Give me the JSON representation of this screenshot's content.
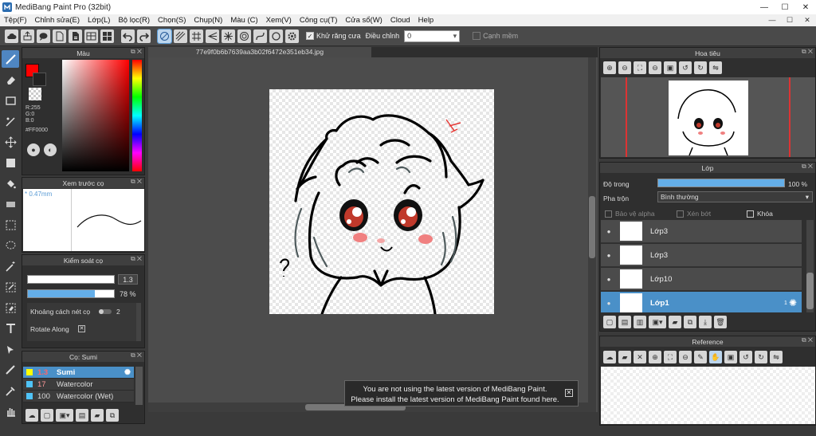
{
  "window": {
    "title": "MediBang Paint Pro (32bit)",
    "minimize": "—",
    "maximize": "☐",
    "close": "✕"
  },
  "menu": [
    "Tệp(F)",
    "Chỉnh sửa(E)",
    "Lớp(L)",
    "Bộ lọc(R)",
    "Chọn(S)",
    "Chụp(N)",
    "Màu (C)",
    "Xem(V)",
    "Công cụ(T)",
    "Cửa sổ(W)",
    "Cloud",
    "Help"
  ],
  "toolbar": {
    "antialias_label": "Khử răng cưa",
    "correction_label": "Điều chỉnh",
    "correction_value": "0",
    "snap_edge_label": "Cạnh mềm"
  },
  "color_panel": {
    "title": "Màu",
    "r": "R:255",
    "g": "G:0",
    "b": "B:0",
    "hex": "#FF0000",
    "primary_color": "#ff0000"
  },
  "brush_preview": {
    "title": "Xem trước cọ",
    "size": "* 0.47mm"
  },
  "brush_control": {
    "title": "Kiểm soát cọ",
    "size_value": "1.3",
    "opacity_value": "78 %",
    "opacity_fraction": 0.78,
    "spacing_label": "Khoảng cách nét cọ",
    "spacing_value": "2",
    "rotate_label": "Rotate Along"
  },
  "brush_list": {
    "title": "Cọ: Sumi",
    "items": [
      {
        "size": "1.3",
        "name": "Sumi",
        "color": "#ffff00",
        "selected": true
      },
      {
        "size": "17",
        "name": "Watercolor",
        "color": "#4fc3f7",
        "selected": false
      },
      {
        "size": "100",
        "name": "Watercolor (Wet)",
        "color": "#4fc3f7",
        "selected": false
      }
    ]
  },
  "document": {
    "tab": "77e9f0b6b7639aa3b02f6472e351eb34.jpg"
  },
  "notice": {
    "line1": "You are not using the latest version of MediBang Paint.",
    "line2": "Please install the latest version of MediBang Paint found here."
  },
  "navigator": {
    "title": "Hoa tiêu"
  },
  "layer_panel": {
    "title": "Lớp",
    "opacity_label": "Độ trong",
    "opacity_value": "100 %",
    "opacity_fraction": 1.0,
    "blend_label": "Pha trộn",
    "blend_value": "Bình thường",
    "protect_alpha": "Bảo vệ alpha",
    "clipping": "Xén bớt",
    "lock": "Khóa",
    "layers": [
      {
        "name": "Lớp3",
        "selected": false
      },
      {
        "name": "Lớp3",
        "selected": false
      },
      {
        "name": "Lớp10",
        "selected": false
      },
      {
        "name": "Lớp1",
        "selected": true,
        "badge": "1"
      }
    ]
  },
  "reference": {
    "title": "Reference"
  }
}
